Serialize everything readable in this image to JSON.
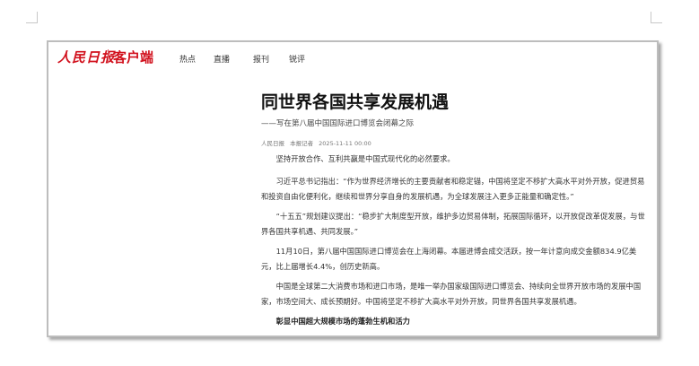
{
  "header": {
    "logo_text": "人民日报",
    "app_name": "客户端",
    "nav": [
      "热点",
      "直播",
      "报刊",
      "锐评"
    ]
  },
  "article": {
    "title": "同世界各国共享发展机遇",
    "subtitle": "——写在第八届中国国际进口博览会闭幕之际",
    "meta": {
      "source": "人民日报",
      "author": "本报记者",
      "datetime": "2025-11-11 00:00"
    },
    "paragraphs": [
      "坚持开放合作、互利共赢是中国式现代化的必然要求。",
      "习近平总书记指出：“作为世界经济增长的主要贡献者和稳定锚，中国将坚定不移扩大高水平对外开放，促进贸易和投资自由化便利化，继续和世界分享自身的发展机遇，为全球发展注入更多正能量和确定性。”",
      "“十五五”规划建议提出：“稳步扩大制度型开放，维护多边贸易体制，拓展国际循环，以开放促改革促发展，与世界各国共享机遇、共同发展。”",
      "11月10日，第八届中国国际进口博览会在上海闭幕。本届进博会成交活跃，按一年计意向成交金额834.9亿美元，比上届增长4.4%，创历史新高。",
      "中国是全球第二大消费市场和进口市场，是唯一举办国家级国际进口博览会、持续向全世界开放市场的发展中国家，市场空间大、成长预期好。中国将坚定不移扩大高水平对外开放，同世界各国共享发展机遇。"
    ],
    "section_heading": "彰显中国超大规模市场的蓬勃生机和活力"
  },
  "colors": {
    "brand_red": "#d1101c"
  }
}
